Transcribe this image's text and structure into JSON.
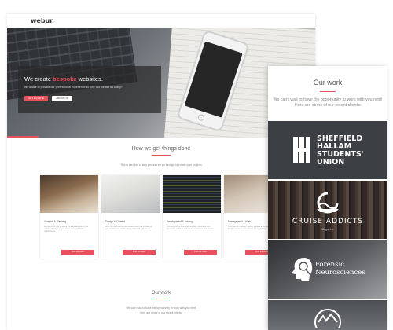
{
  "site": {
    "logo": "webur."
  },
  "hero": {
    "title_prefix": "We create ",
    "title_highlight": "bespoke",
    "title_suffix": " websites.",
    "subtitle": "We'd love to provide our professional experience so why not contact us today?",
    "primary_button": "GET A QUOTE",
    "secondary_button": "ABOUT US"
  },
  "process": {
    "title": "How we get things done",
    "subtitle": "This is the idea to step process we go through to create your projects",
    "cards": [
      {
        "title": "Analysis & Planning",
        "body": "We start each site by laying out a detailed plan of the website structure, pages, content and technical requirements.",
        "button": "Find out more"
      },
      {
        "title": "Design & Content",
        "body": "With the brand identity and content direct we produce an eye-catching and usable design which fits your needs.",
        "button": "Find out more"
      },
      {
        "title": "Development & Testing",
        "body": "Our designs are developed into fast, responsive and accessible websites tested across browsers and devices.",
        "button": "Find out more"
      },
      {
        "title": "Management & Web",
        "body": "Once live we manage hosting, updates and ongoing improvements so your website keeps growing.",
        "button": "Find out more"
      }
    ]
  },
  "work_main": {
    "title": "Our work",
    "subtitle_line1": "We can't wait to have the opportunity to work with you next!",
    "subtitle_line2": "Here are some of our recent clients:"
  },
  "work_mobile": {
    "title": "Our work",
    "subtitle_line1": "We can't wait to have the opportunity to work with you next!",
    "subtitle_line2": "Here are some of our recent clients:",
    "clients": [
      {
        "name_lines": [
          "SHEFFIELD",
          "HALLAM",
          "STUDENTS'",
          "UNION"
        ]
      },
      {
        "name": "CRUISE ADDICTS",
        "tagline": "Magazine"
      },
      {
        "name_lines": [
          "Forensic",
          "Neurosciences"
        ]
      }
    ]
  },
  "colors": {
    "accent": "#e8505b",
    "dark_overlay": "#282828",
    "text_muted": "#888888"
  }
}
